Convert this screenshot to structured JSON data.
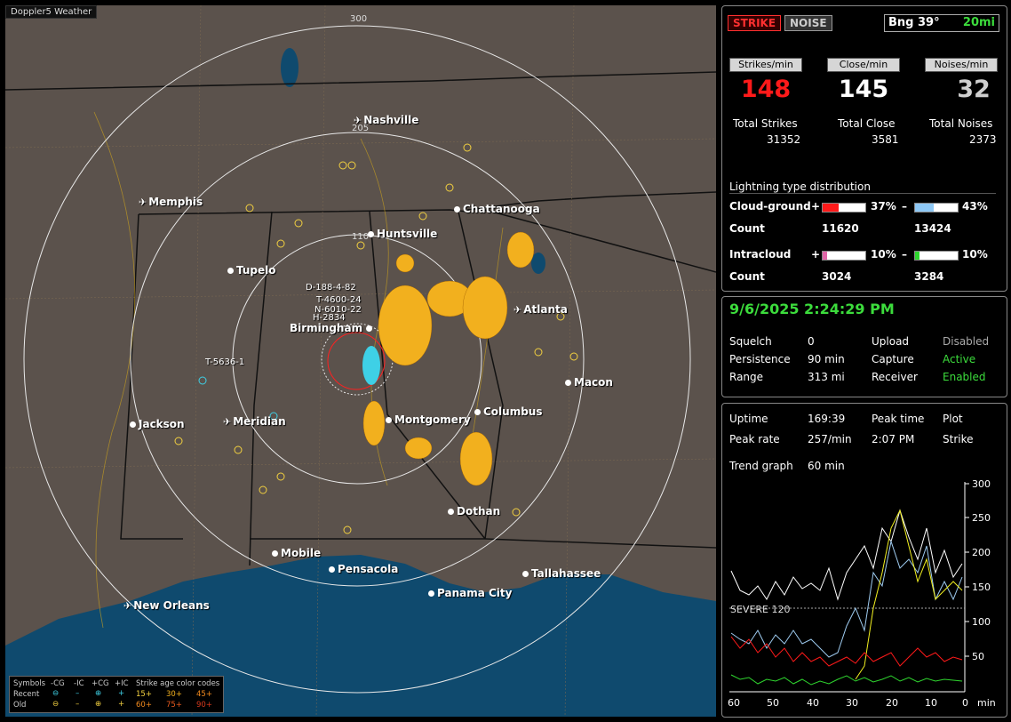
{
  "window_title": "Doppler5 Weather",
  "map": {
    "ring_labels": [
      "300",
      "205",
      "110"
    ],
    "cities": [
      {
        "name": "Nashville",
        "kind": "plane"
      },
      {
        "name": "Memphis",
        "kind": "plane"
      },
      {
        "name": "Chattanooga",
        "kind": "dot"
      },
      {
        "name": "Huntsville",
        "kind": "dot"
      },
      {
        "name": "Tupelo",
        "kind": "dot"
      },
      {
        "name": "Birmingham",
        "kind": "dot"
      },
      {
        "name": "Atlanta",
        "kind": "plane"
      },
      {
        "name": "Macon",
        "kind": "dot"
      },
      {
        "name": "Columbus",
        "kind": "dot"
      },
      {
        "name": "Montgomery",
        "kind": "dot"
      },
      {
        "name": "Jackson",
        "kind": "dot"
      },
      {
        "name": "Meridian",
        "kind": "plane"
      },
      {
        "name": "Dothan",
        "kind": "dot"
      },
      {
        "name": "Mobile",
        "kind": "dot"
      },
      {
        "name": "Pensacola",
        "kind": "dot"
      },
      {
        "name": "Tallahassee",
        "kind": "dot"
      },
      {
        "name": "Panama City",
        "kind": "dot"
      },
      {
        "name": "New Orleans",
        "kind": "plane"
      }
    ],
    "annotations": [
      "D-188-4-82",
      "T-4600-24",
      "N-6010-22",
      "H-2834",
      "T-5636-1"
    ]
  },
  "legend": {
    "symbols_label": "Symbols",
    "types": [
      "-CG",
      "-IC",
      "+CG",
      "+IC"
    ],
    "age_label": "Strike age color codes",
    "recent_label": "Recent",
    "old_label": "Old",
    "recent_ages": [
      "15+",
      "30+",
      "45+"
    ],
    "old_ages": [
      "60+",
      "75+",
      "90+"
    ]
  },
  "top": {
    "strike_tab": "STRIKE",
    "noise_tab": "NOISE",
    "bearing": "Bng 39°",
    "range": "20mi",
    "strikes_min_label": "Strikes/min",
    "close_min_label": "Close/min",
    "noises_min_label": "Noises/min",
    "strikes_min": "148",
    "close_min": "145",
    "noises_min": "32",
    "total_strikes_label": "Total Strikes",
    "total_close_label": "Total Close",
    "total_noises_label": "Total Noises",
    "total_strikes": "31352",
    "total_close": "3581",
    "total_noises": "2373",
    "dist_title": "Lightning type distribution",
    "cg_label": "Cloud-ground",
    "ic_label": "Intracloud",
    "count_label": "Count",
    "cg_pos_pct": "37%",
    "cg_neg_pct": "43%",
    "cg_pos_count": "11620",
    "cg_neg_count": "13424",
    "ic_pos_pct": "10%",
    "ic_neg_pct": "10%",
    "ic_pos_count": "3024",
    "ic_neg_count": "3284",
    "cg_pos_frac": 0.37,
    "cg_neg_frac": 0.43,
    "ic_pos_frac": 0.1,
    "ic_neg_frac": 0.1
  },
  "status": {
    "datetime": "9/6/2025 2:24:29 PM",
    "squelch_label": "Squelch",
    "squelch": "0",
    "persistence_label": "Persistence",
    "persistence": "90 min",
    "range_label": "Range",
    "range": "313 mi",
    "upload_label": "Upload",
    "upload": "Disabled",
    "capture_label": "Capture",
    "capture": "Active",
    "receiver_label": "Receiver",
    "receiver": "Enabled"
  },
  "trend": {
    "uptime_label": "Uptime",
    "uptime": "169:39",
    "peak_time_label": "Peak time",
    "peak_time": "2:07 PM",
    "plot_label": "Plot",
    "plot": "Strike",
    "peak_rate_label": "Peak rate",
    "peak_rate": "257/min",
    "trend_graph_label": "Trend graph",
    "trend_graph": "60 min",
    "severe_label": "SEVERE 120",
    "y_ticks": [
      "300",
      "250",
      "200",
      "150",
      "100",
      "50"
    ],
    "x_ticks": [
      "60",
      "50",
      "40",
      "30",
      "20",
      "10",
      "0"
    ],
    "x_unit": "min"
  },
  "colors": {
    "strike_red": "#ff1a1a",
    "noise_gray": "#cfcfcf",
    "accent_green": "#3cdc3c",
    "cg_pos": "#ff1a1a",
    "cg_neg": "#8ec8f5",
    "ic_pos": "#e066a8",
    "ic_neg": "#2fd62f"
  }
}
